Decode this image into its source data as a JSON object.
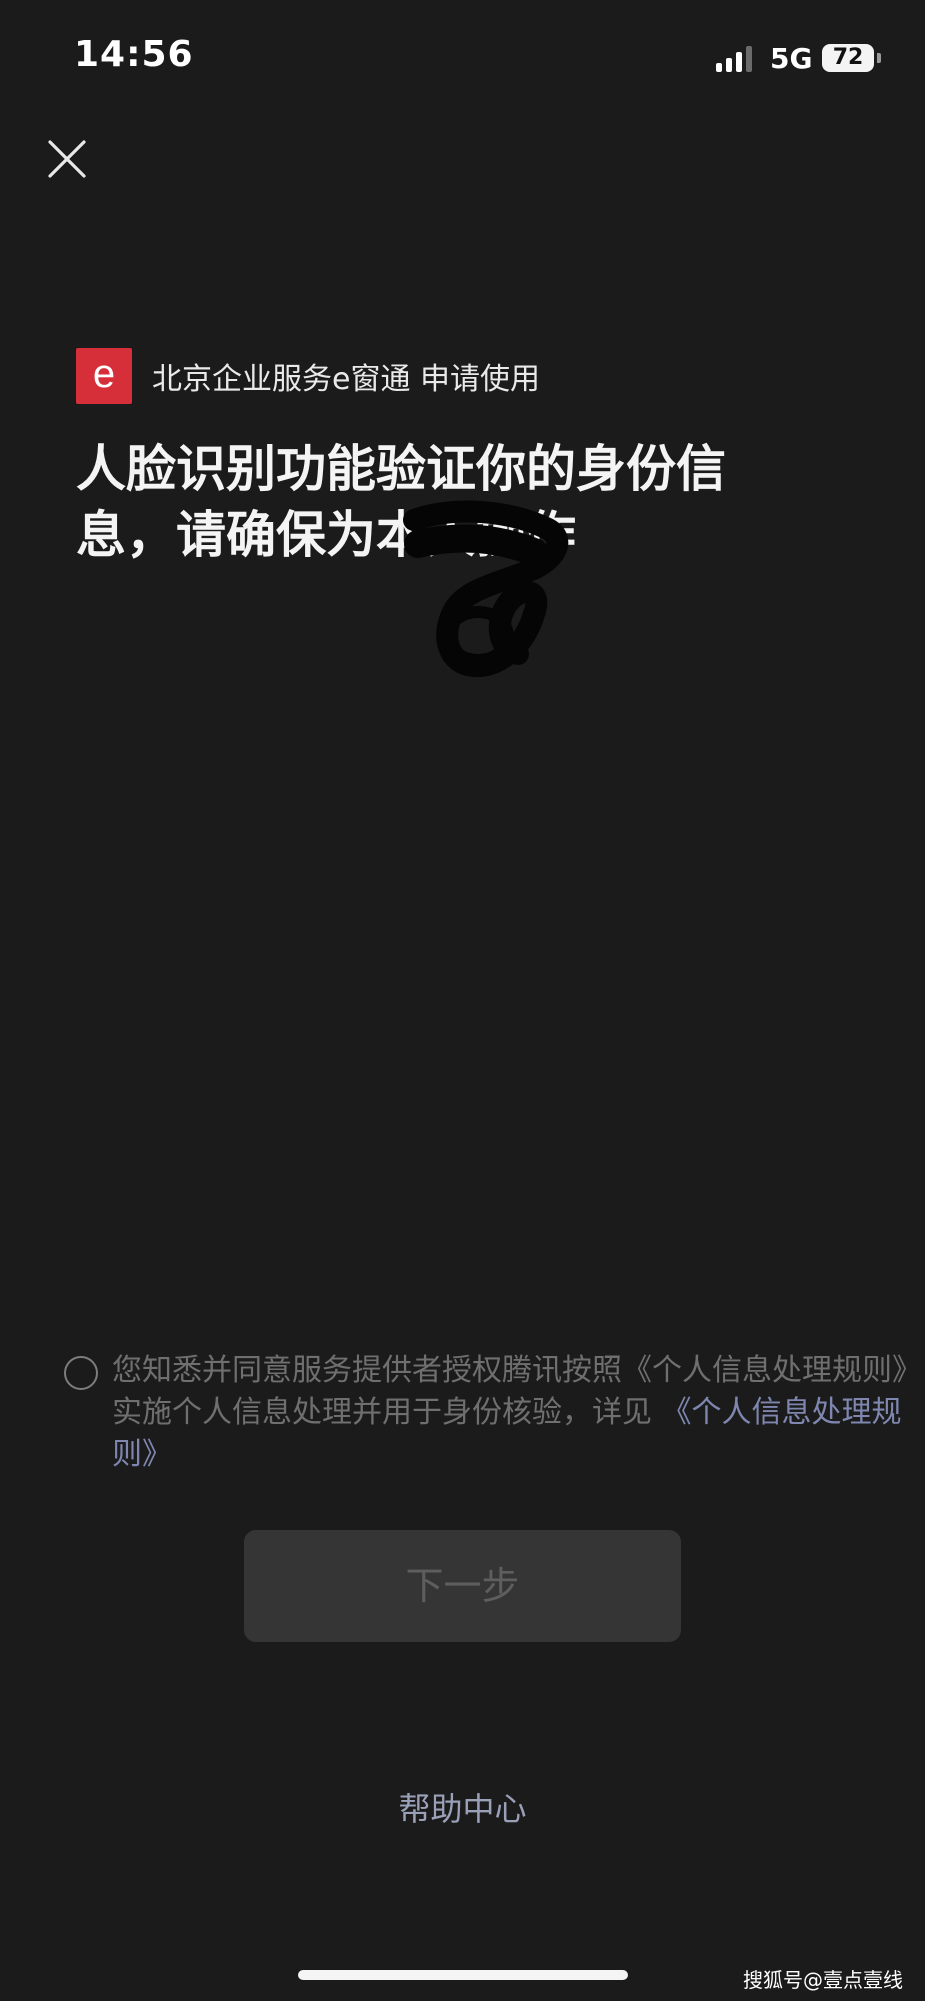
{
  "status_bar": {
    "time": "14:56",
    "network": "5G",
    "battery": "72",
    "signal_icon": "signal-icon"
  },
  "header": {
    "close_icon": "close-icon",
    "app_logo_letter": "e",
    "app_name": "北京企业服务e窗通 申请使用",
    "headline": "人脸识别功能验证你的身份信息，请确保为本人操作",
    "brand_color": "#d62f3a"
  },
  "agreement": {
    "radio_checked": false,
    "text_before": "您知悉并同意服务提供者授权腾讯按照《个人信息处理规则》实施个人信息处理并用于身份核验，详见 ",
    "link_text": "《个人信息处理规则》"
  },
  "actions": {
    "next_label": "下一步",
    "help_label": "帮助中心"
  },
  "watermark": {
    "text": "搜狐号@壹点壹线"
  }
}
